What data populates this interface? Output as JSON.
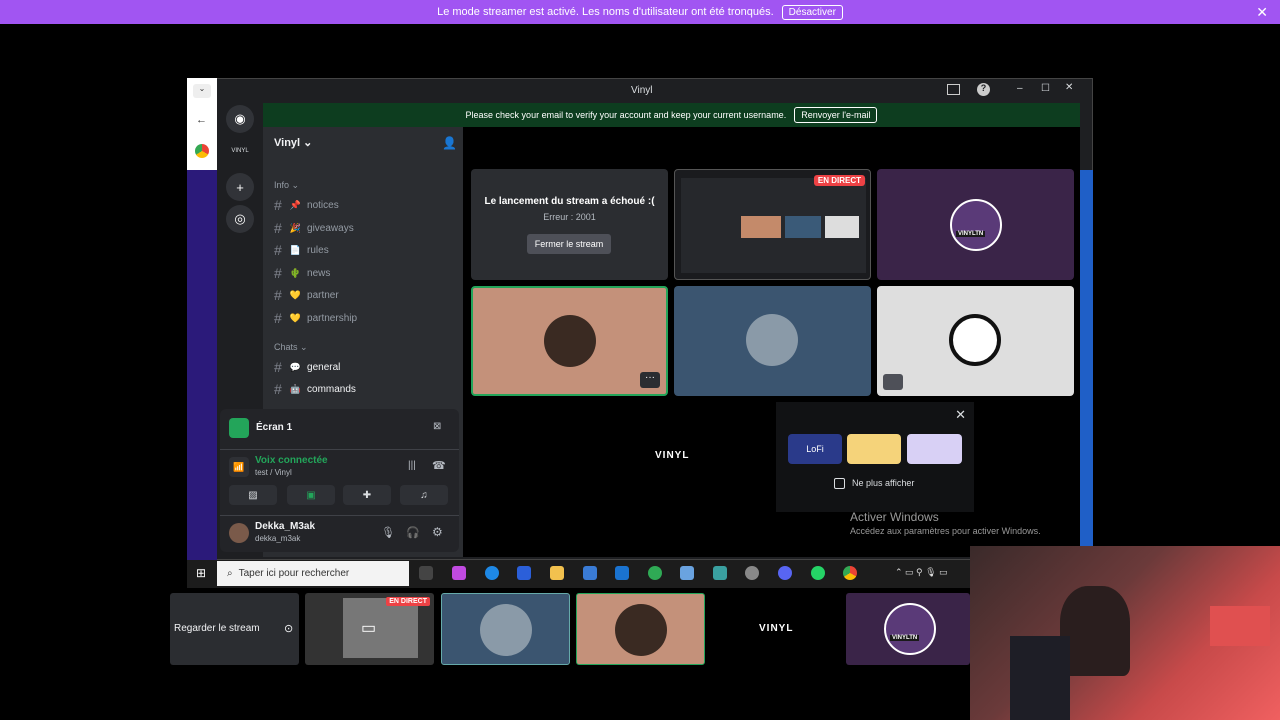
{
  "banner": {
    "text": "Le mode streamer est activé. Les noms d'utilisateur ont été tronqués.",
    "button": "Désactiver"
  },
  "window": {
    "title": "Vinyl"
  },
  "emailbar": {
    "text": "Please check your email to verify your account and keep your current username.",
    "button": "Renvoyer l'e-mail"
  },
  "server": {
    "name": "Vinyl",
    "rail_label": "VINYL"
  },
  "categories": {
    "info": "Info",
    "chats": "Chats"
  },
  "channels": [
    {
      "emoji": "📌",
      "name": "notices"
    },
    {
      "emoji": "🎉",
      "name": "giveaways"
    },
    {
      "emoji": "📄",
      "name": "rules"
    },
    {
      "emoji": "🌵",
      "name": "news"
    },
    {
      "emoji": "💛",
      "name": "partner"
    },
    {
      "emoji": "💛",
      "name": "partnership"
    },
    {
      "emoji": "💬",
      "name": "general"
    },
    {
      "emoji": "🤖",
      "name": "commands"
    }
  ],
  "stream_error": {
    "title": "Le lancement du stream a échoué :(",
    "code": "Erreur : 2001",
    "button": "Fermer le stream"
  },
  "live_badge": "EN DIRECT",
  "vinyltn_label": "VINYLTN",
  "vinyl_label": "VINYL",
  "promo": {
    "checkbox_label": "Ne plus afficher",
    "card1": "LoFi"
  },
  "windows_activation": {
    "title": "Activer Windows",
    "subtitle": "Accédez aux paramètres pour activer Windows."
  },
  "voice_panel": {
    "screen_label": "Écran 1",
    "status": "Voix connectée",
    "channel": "test / Vinyl",
    "username": "Dekka_M3ak",
    "handle": "dekka_m3ak"
  },
  "taskbar": {
    "search_placeholder": "Taper ici pour rechercher"
  },
  "bottom": {
    "watch_label": "Regarder le stream"
  },
  "colors": {
    "banner": "#a155f2",
    "discord_green": "#23a55a",
    "live_red": "#ed4245"
  }
}
